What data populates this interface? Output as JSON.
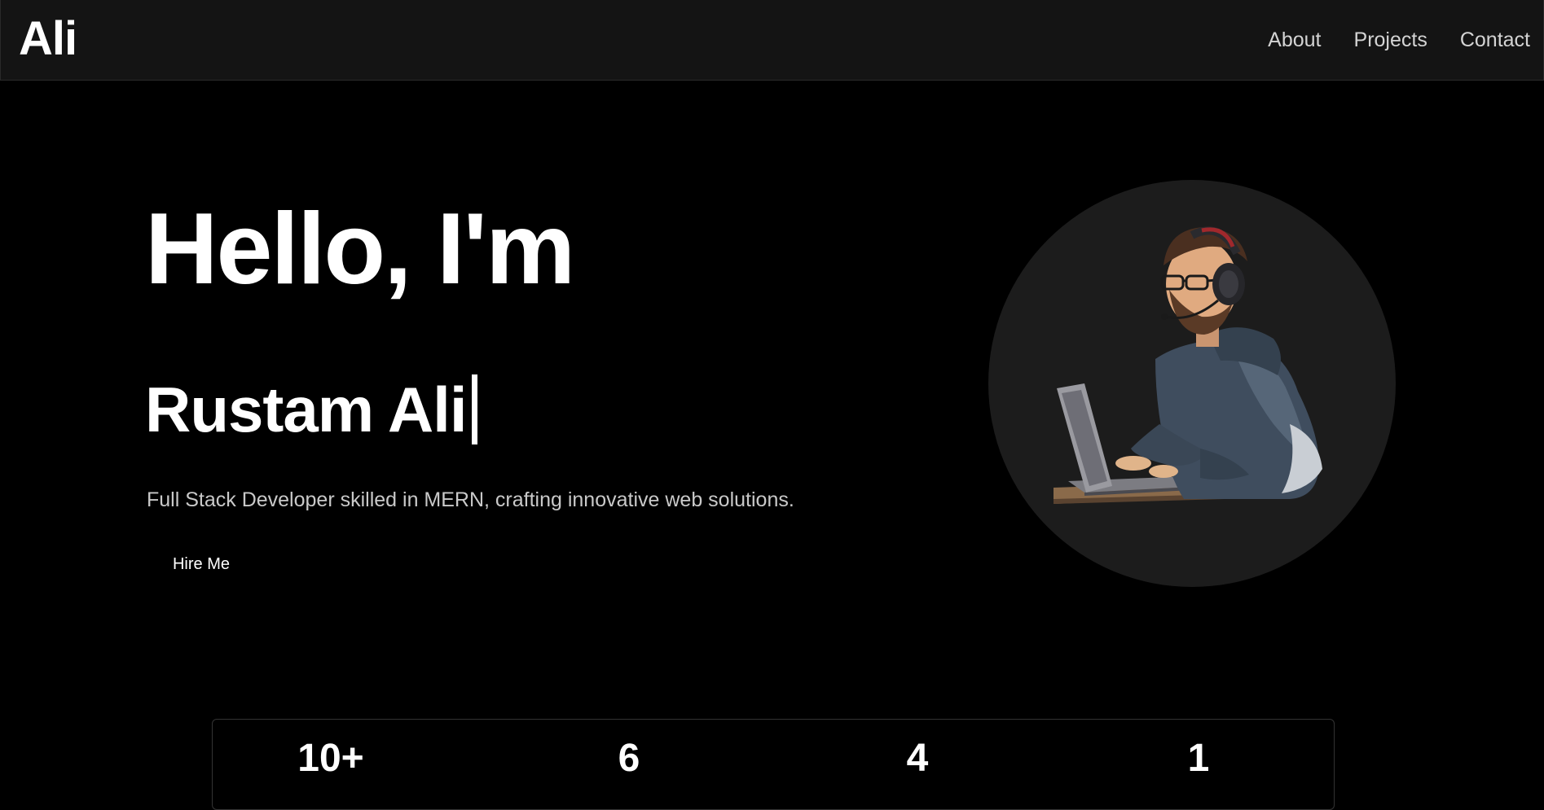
{
  "header": {
    "logo": "Ali",
    "nav": [
      {
        "label": "About"
      },
      {
        "label": "Projects"
      },
      {
        "label": "Contact"
      }
    ]
  },
  "hero": {
    "greeting": "Hello, I'm",
    "name": "Rustam Ali",
    "description": "Full Stack Developer skilled in MERN, crafting innovative web solutions.",
    "cta_label": "Hire Me",
    "illustration": "developer-at-laptop-illustration"
  },
  "stats": [
    {
      "value": "10+"
    },
    {
      "value": "6"
    },
    {
      "value": "4"
    },
    {
      "value": "1"
    }
  ],
  "colors": {
    "background": "#000000",
    "navbar": "#141414",
    "avatar_bg": "#1c1c1c",
    "text": "#ffffff",
    "muted_text": "#c9c9c9"
  }
}
